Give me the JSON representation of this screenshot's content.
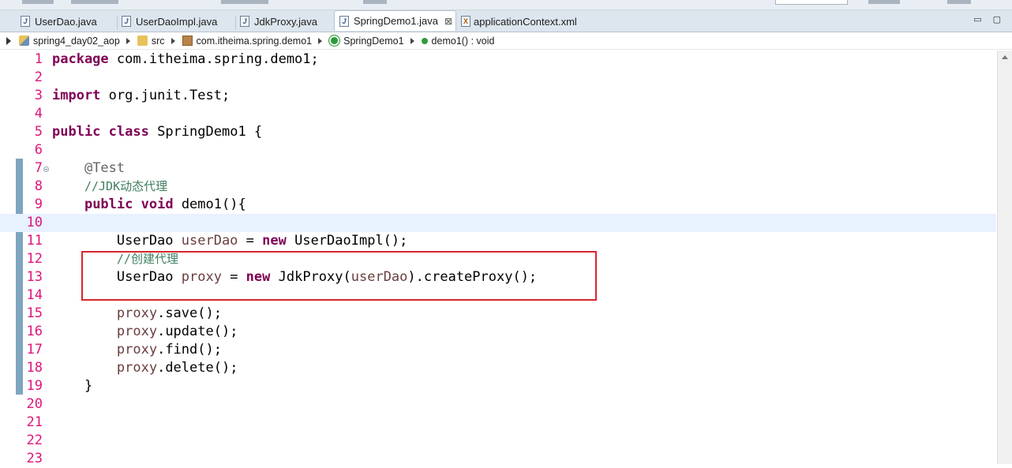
{
  "tabs": [
    {
      "label": "UserDao.java",
      "icon": "java-file-icon",
      "active": false
    },
    {
      "label": "UserDaoImpl.java",
      "icon": "java-file-icon",
      "active": false
    },
    {
      "label": "JdkProxy.java",
      "icon": "java-file-icon",
      "active": false
    },
    {
      "label": "SpringDemo1.java",
      "icon": "java-file-icon",
      "active": true,
      "close": "⊠"
    },
    {
      "label": "applicationContext.xml",
      "icon": "xml-file-icon",
      "active": false
    }
  ],
  "icon_glyphs": {
    "java": "J",
    "xml": "X"
  },
  "window_controls": {
    "minimize": "▭",
    "maximize": "▢"
  },
  "breadcrumb": [
    {
      "label": "spring4_day02_aop",
      "icon": "project-icon"
    },
    {
      "label": "src",
      "icon": "source-folder-icon"
    },
    {
      "label": "com.itheima.spring.demo1",
      "icon": "package-icon"
    },
    {
      "label": "SpringDemo1",
      "icon": "class-icon"
    },
    {
      "label": "demo1() : void",
      "icon": "method-icon"
    }
  ],
  "editor": {
    "line_numbers": [
      "1",
      "2",
      "3",
      "4",
      "5",
      "6",
      "7",
      "8",
      "9",
      "10",
      "11",
      "12",
      "13",
      "14",
      "15",
      "16",
      "17",
      "18",
      "19",
      "20",
      "21",
      "22",
      "23"
    ],
    "current_line": 10,
    "tokens": {
      "l1": [
        "package",
        " com.itheima.spring.demo1;"
      ],
      "l3": [
        "import",
        " org.junit.Test;"
      ],
      "l5": [
        "public",
        " ",
        "class",
        " SpringDemo1 {"
      ],
      "l7": [
        "    ",
        "@Test"
      ],
      "l8": [
        "    ",
        "//JDK动态代理"
      ],
      "l9": [
        "    ",
        "public",
        " ",
        "void",
        " demo1(){"
      ],
      "l11": [
        "        UserDao ",
        "userDao",
        " = ",
        "new",
        " UserDaoImpl();"
      ],
      "l12": [
        "        ",
        "//创建代理"
      ],
      "l13": [
        "        UserDao ",
        "proxy",
        " = ",
        "new",
        " JdkProxy(",
        "userDao",
        ").createProxy();"
      ],
      "l15": [
        "        ",
        "proxy",
        ".save();"
      ],
      "l16": [
        "        ",
        "proxy",
        ".update();"
      ],
      "l17": [
        "        ",
        "proxy",
        ".find();"
      ],
      "l18": [
        "        ",
        "proxy",
        ".delete();"
      ],
      "l19": [
        "    }"
      ]
    }
  },
  "colors": {
    "keyword": "#7f0055",
    "annotation": "#646464",
    "comment": "#3f7f5f",
    "variable": "#6a3e3e",
    "line_number": "#e0147a",
    "highlight_box": "#d8262f",
    "current_line_bg": "#e8f2fe"
  }
}
